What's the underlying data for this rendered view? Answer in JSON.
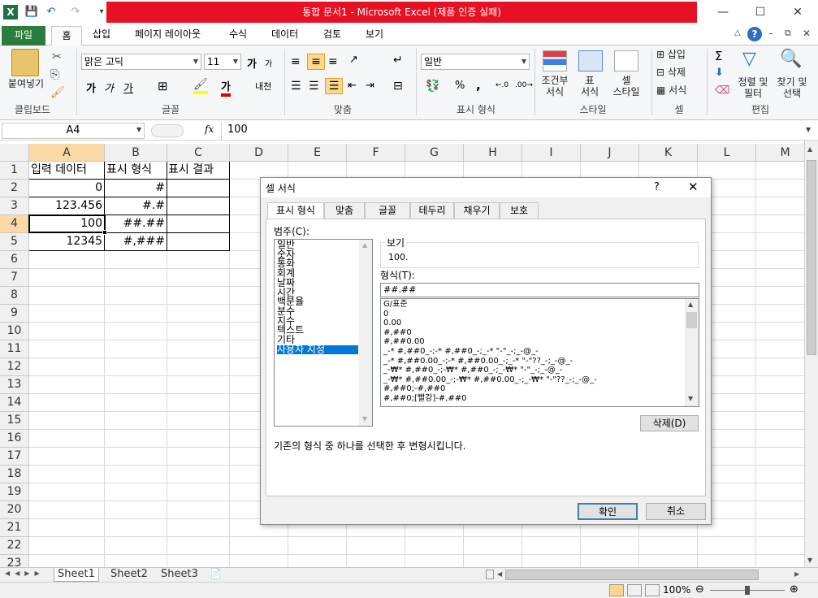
{
  "titlebar": {
    "title": "통합 문서1  -  Microsoft Excel (제품 인증 실패)",
    "app_icon": "X",
    "minimize": "—",
    "maximize": "☐",
    "close": "✕"
  },
  "ribbon_tabs": [
    "파일",
    "홈",
    "삽입",
    "페이지 레이아웃",
    "수식",
    "데이터",
    "검토",
    "보기"
  ],
  "ribbon": {
    "clipboard": {
      "paste": "붙여넣기",
      "label": "클립보드"
    },
    "font": {
      "name": "맑은 고딕",
      "size": "11",
      "label": "글꼴",
      "bold": "가",
      "italic": "가",
      "underline": "가",
      "grow": "가",
      "shrink": "가",
      "color": "가",
      "phonetic": "내천"
    },
    "align": {
      "label": "맞춤"
    },
    "number": {
      "format": "일반",
      "label": "표시 형식",
      "percent": "%",
      "comma": ","
    },
    "styles": {
      "cond_format": "조건부\n서식",
      "table_format": "표\n서식",
      "cell_style": "셀\n스타일",
      "label": "스타일"
    },
    "cells": {
      "insert": "삽입",
      "delete": "삭제",
      "format": "서식",
      "label": "셀"
    },
    "editing": {
      "sort": "정렬 및\n필터",
      "find": "찾기 및\n선택",
      "label": "편집",
      "sigma": "Σ"
    }
  },
  "formula_bar": {
    "name_box": "A4",
    "fx": "fx",
    "value": "100"
  },
  "columns": [
    "A",
    "B",
    "C",
    "D",
    "E",
    "F",
    "G",
    "H",
    "I",
    "J",
    "K",
    "L",
    "M"
  ],
  "rows": [
    "1",
    "2",
    "3",
    "4",
    "5",
    "6",
    "7",
    "8",
    "9",
    "10",
    "11",
    "12",
    "13",
    "14",
    "15",
    "16",
    "17",
    "18",
    "19",
    "20",
    "21",
    "22",
    "23"
  ],
  "cells": {
    "A1": "입력 데이터",
    "B1": "표시 형식",
    "C1": "표시 결과",
    "A2": "0",
    "B2": "#",
    "A3": "123.456",
    "B3": "#.#",
    "A4": "100",
    "B4": "##.##",
    "A5": "12345",
    "B5": "#,###"
  },
  "sheets": [
    "Sheet1",
    "Sheet2",
    "Sheet3"
  ],
  "status": {
    "zoom": "100%"
  },
  "dialog": {
    "title": "셀 서식",
    "help": "?",
    "close": "✕",
    "tabs": [
      "표시 형식",
      "맞춤",
      "글꼴",
      "테두리",
      "채우기",
      "보호"
    ],
    "category_label": "범주(C):",
    "categories": [
      "일반",
      "숫자",
      "통화",
      "회계",
      "날짜",
      "시간",
      "백분율",
      "분수",
      "지수",
      "텍스트",
      "기타",
      "사용자 지정"
    ],
    "selected_category": "사용자 지정",
    "sample_label": "보기",
    "sample_value": "100.",
    "type_label": "형식(T):",
    "type_value": "##.##",
    "formats": [
      "G/표준",
      "0",
      "0.00",
      "#,##0",
      "#,##0.00",
      "_-* #,##0_-;-* #,##0_-;_-* \"-\"_-;_-@_-",
      "_-* #,##0.00_-;-* #,##0.00_-;_-* \"-\"??_-;_-@_-",
      "_-₩* #,##0_-;-₩* #,##0_-;_-₩* \"-\"_-;_-@_-",
      "_-₩* #,##0.00_-;-₩* #,##0.00_-;_-₩* \"-\"??_-;_-@_-",
      "#,##0;-#,##0",
      "#,##0;[빨강]-#,##0"
    ],
    "delete_button": "삭제(D)",
    "hint": "기존의 형식 중 하나를 선택한 후 변형시킵니다.",
    "ok": "확인",
    "cancel": "취소"
  }
}
